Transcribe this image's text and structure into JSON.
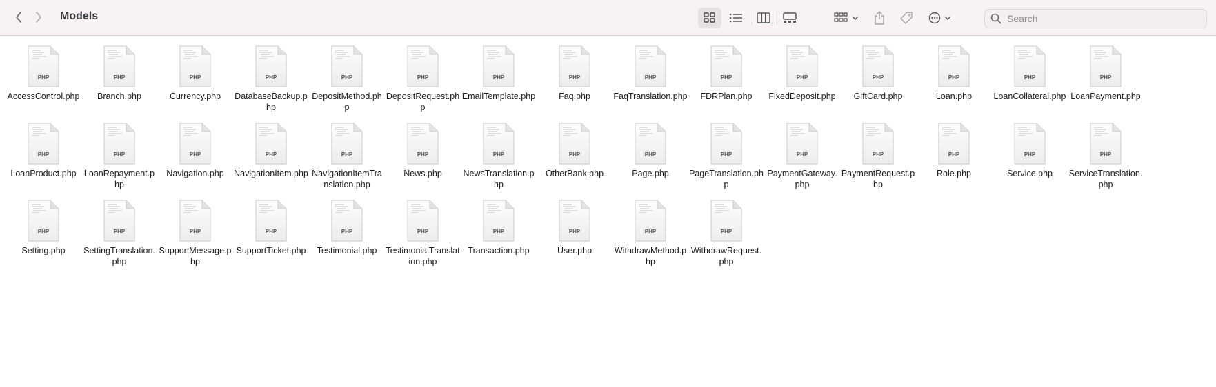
{
  "window": {
    "title": "Models"
  },
  "toolbar": {
    "back_icon": "chevron-left-icon",
    "forward_icon": "chevron-right-icon",
    "view_buttons": [
      "icon-view",
      "list-view",
      "column-view",
      "gallery-view"
    ],
    "group_icon": "group-icon",
    "share_icon": "share-icon",
    "tag_icon": "tag-icon",
    "more_icon": "ellipsis-circle-icon",
    "search_placeholder": "Search"
  },
  "file_icon": {
    "badge": "PHP",
    "icon": "php-document-icon"
  },
  "files": [
    {
      "name": "AccessControl.php"
    },
    {
      "name": "Branch.php"
    },
    {
      "name": "Currency.php"
    },
    {
      "name": "DatabaseBackup.php"
    },
    {
      "name": "DepositMethod.php"
    },
    {
      "name": "DepositRequest.php"
    },
    {
      "name": "EmailTemplate.php"
    },
    {
      "name": "Faq.php"
    },
    {
      "name": "FaqTranslation.php"
    },
    {
      "name": "FDRPlan.php"
    },
    {
      "name": "FixedDeposit.php"
    },
    {
      "name": "GiftCard.php"
    },
    {
      "name": "Loan.php"
    },
    {
      "name": "LoanCollateral.php"
    },
    {
      "name": "LoanPayment.php"
    },
    {
      "name": "LoanProduct.php"
    },
    {
      "name": "LoanRepayment.php"
    },
    {
      "name": "Navigation.php"
    },
    {
      "name": "NavigationItem.php"
    },
    {
      "name": "NavigationItemTranslation.php"
    },
    {
      "name": "News.php"
    },
    {
      "name": "NewsTranslation.php"
    },
    {
      "name": "OtherBank.php"
    },
    {
      "name": "Page.php"
    },
    {
      "name": "PageTranslation.php"
    },
    {
      "name": "PaymentGateway.php"
    },
    {
      "name": "PaymentRequest.php"
    },
    {
      "name": "Role.php"
    },
    {
      "name": "Service.php"
    },
    {
      "name": "ServiceTranslation.php"
    },
    {
      "name": "Setting.php"
    },
    {
      "name": "SettingTranslation.php"
    },
    {
      "name": "SupportMessage.php"
    },
    {
      "name": "SupportTicket.php"
    },
    {
      "name": "Testimonial.php"
    },
    {
      "name": "TestimonialTranslation.php"
    },
    {
      "name": "Transaction.php"
    },
    {
      "name": "User.php"
    },
    {
      "name": "WithdrawMethod.php"
    },
    {
      "name": "WithdrawRequest.php"
    }
  ]
}
